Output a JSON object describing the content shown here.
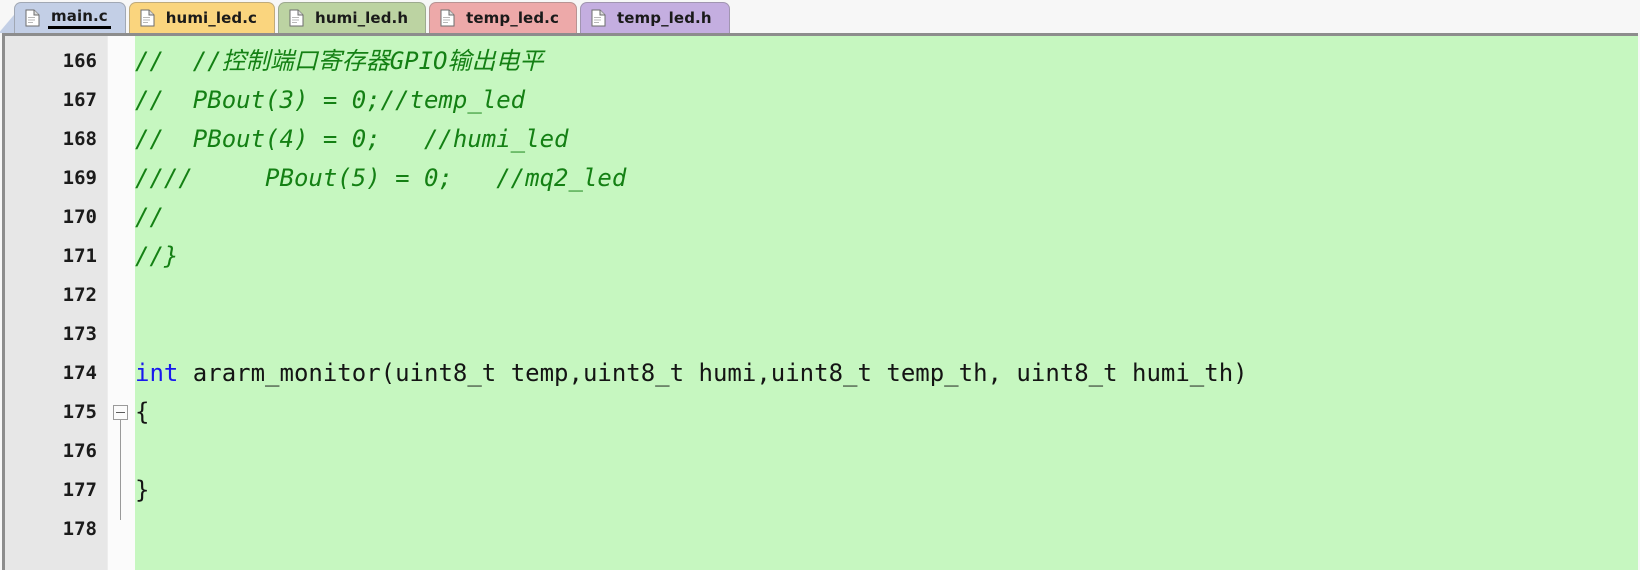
{
  "window": {
    "title": "main.c",
    "accent_active_tab": "#c3cfe6",
    "editor_background": "#c6f7c0",
    "gutter_background": "#e7e7e7",
    "comment_color": "#148014",
    "keyword_color": "#1919ee"
  },
  "tabs": [
    {
      "label": "main.c",
      "icon": "file-page-icon",
      "color": "#c3cfe6",
      "active": true
    },
    {
      "label": "humi_led.c",
      "icon": "file-page-icon",
      "color": "#fad57e",
      "active": false
    },
    {
      "label": "humi_led.h",
      "icon": "file-page-icon",
      "color": "#bcd3a2",
      "active": false
    },
    {
      "label": "temp_led.c",
      "icon": "file-page-icon",
      "color": "#eda9a9",
      "active": false
    },
    {
      "label": "temp_led.h",
      "icon": "file-page-icon",
      "color": "#c4aee0",
      "active": false
    }
  ],
  "editor": {
    "first_line_number": 166,
    "fold_marker": {
      "line": 175,
      "state": "expanded",
      "glyph": "-"
    },
    "lines": [
      {
        "number": "166",
        "kind": "comment",
        "text": "//  //控制端口寄存器GPIO输出电平"
      },
      {
        "number": "167",
        "kind": "comment",
        "text": "//  PBout(3) = 0;//temp_led"
      },
      {
        "number": "168",
        "kind": "comment",
        "text": "//  PBout(4) = 0;   //humi_led"
      },
      {
        "number": "169",
        "kind": "comment",
        "text": "////     PBout(5) = 0;   //mq2_led"
      },
      {
        "number": "170",
        "kind": "comment",
        "text": "//"
      },
      {
        "number": "171",
        "kind": "comment",
        "text": "//}"
      },
      {
        "number": "172",
        "kind": "blank",
        "text": ""
      },
      {
        "number": "173",
        "kind": "blank",
        "text": ""
      },
      {
        "number": "174",
        "kind": "code",
        "keyword": "int",
        "text": " ararm_monitor(uint8_t temp,uint8_t humi,uint8_t temp_th, uint8_t humi_th)"
      },
      {
        "number": "175",
        "kind": "code",
        "text": "{"
      },
      {
        "number": "176",
        "kind": "blank",
        "text": ""
      },
      {
        "number": "177",
        "kind": "code",
        "text": "}"
      },
      {
        "number": "178",
        "kind": "blank",
        "text": ""
      }
    ]
  }
}
